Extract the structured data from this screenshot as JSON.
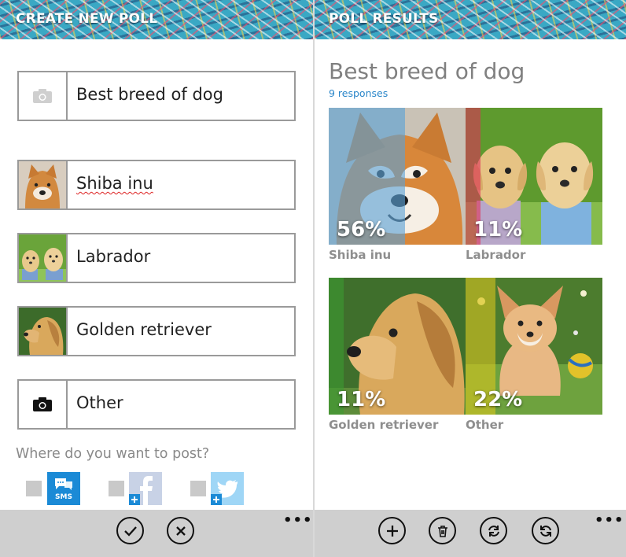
{
  "create": {
    "title": "CREATE NEW POLL",
    "question": "Best breed of dog",
    "options": [
      "Shiba inu",
      "Labrador",
      "Golden retriever",
      "Other"
    ],
    "post_prompt": "Where do you want to post?",
    "sms_label": "SMS",
    "icons": [
      "camera-icon",
      "sms-icon",
      "facebook-icon",
      "twitter-icon",
      "checkmark-icon",
      "cancel-icon",
      "more-icon"
    ]
  },
  "results": {
    "title": "POLL RESULTS",
    "question": "Best breed of dog",
    "responses": "9 responses",
    "items": [
      {
        "label": "Shiba inu",
        "percent": "56%",
        "share": 0.56
      },
      {
        "label": "Labrador",
        "percent": "11%",
        "share": 0.11
      },
      {
        "label": "Golden retriever",
        "percent": "11%",
        "share": 0.11
      },
      {
        "label": "Other",
        "percent": "22%",
        "share": 0.22
      }
    ],
    "icons": [
      "add-icon",
      "delete-icon",
      "refresh-icon",
      "sync-icon",
      "more-icon"
    ]
  },
  "colors": {
    "header": "#3aa8c4",
    "link": "#2a86c9",
    "sms": "#1b8ad6",
    "facebook": "#3b5998",
    "twitter": "#55acee",
    "shiba_overlay": "#5aa2d6",
    "lab_overlay": "#e0305a",
    "golden_overlay": "#3c9b32",
    "other_overlay": "#d8c420"
  }
}
